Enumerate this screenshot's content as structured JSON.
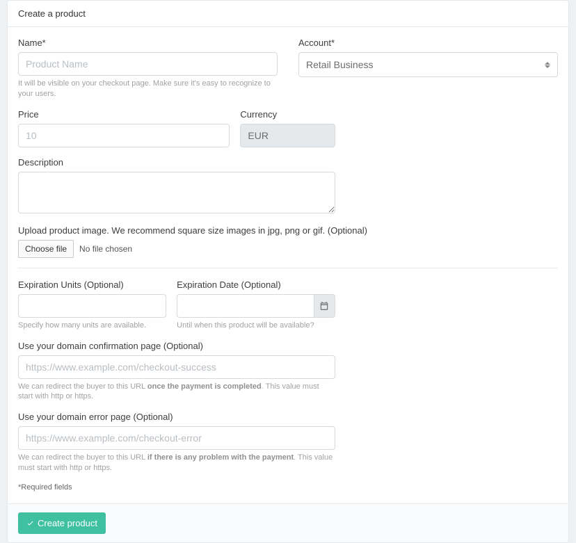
{
  "header": {
    "title": "Create a product"
  },
  "name": {
    "label": "Name*",
    "placeholder": "Product Name",
    "help": "It will be visible on your checkout page. Make sure it's easy to recognize to your users."
  },
  "account": {
    "label": "Account*",
    "value": "Retail Business"
  },
  "price": {
    "label": "Price",
    "placeholder": "10"
  },
  "currency": {
    "label": "Currency",
    "value": "EUR"
  },
  "description": {
    "label": "Description"
  },
  "upload": {
    "label": "Upload product image. We recommend square size images in jpg, png or gif. (Optional)",
    "button": "Choose file",
    "status": "No file chosen"
  },
  "exp_units": {
    "label": "Expiration Units (Optional)",
    "help": "Specify how many units are available."
  },
  "exp_date": {
    "label": "Expiration Date (Optional)",
    "help": "Until when this product will be available?"
  },
  "confirmation": {
    "label": "Use your domain confirmation page (Optional)",
    "placeholder": "https://www.example.com/checkout-success",
    "help_pre": "We can redirect the buyer to this URL ",
    "help_bold": "once the payment is completed",
    "help_post": ". This value must start with http or https."
  },
  "error_page": {
    "label": "Use your domain error page (Optional)",
    "placeholder": "https://www.example.com/checkout-error",
    "help_pre": "We can redirect the buyer to this URL ",
    "help_bold": "if there is any problem with the payment",
    "help_post": ". This value must start with http or https."
  },
  "required_note": "*Required fields",
  "submit": {
    "label": "Create product"
  }
}
